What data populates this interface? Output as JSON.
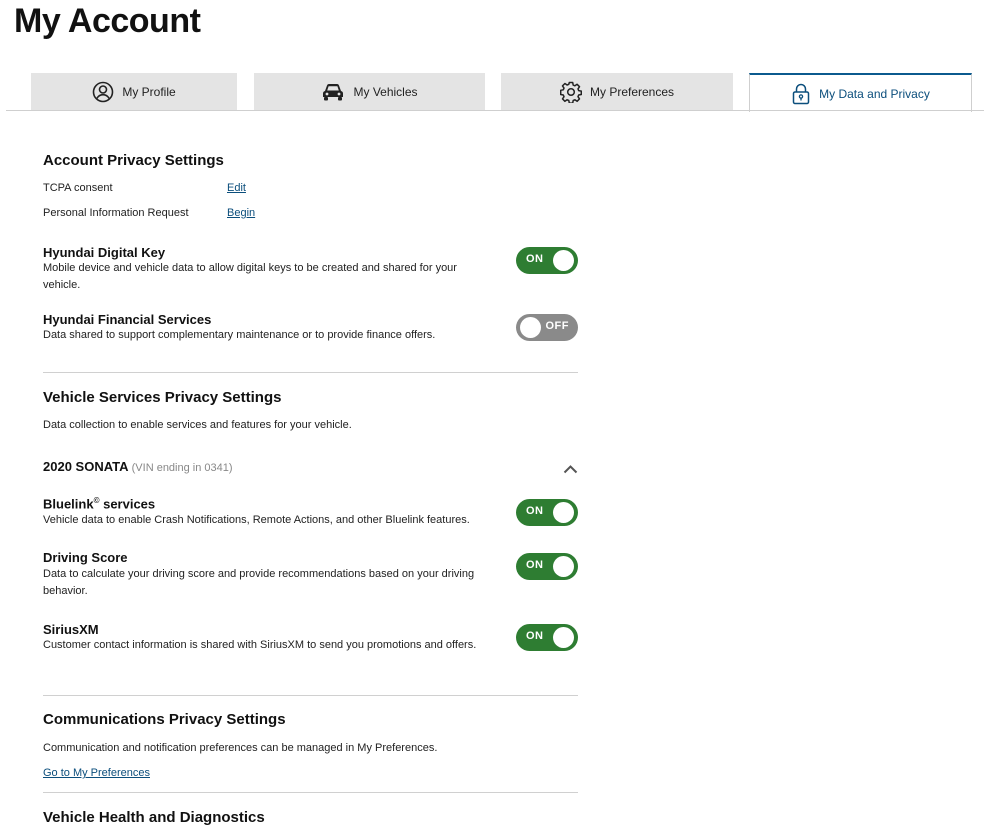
{
  "page_title": "My Account",
  "tabs": [
    {
      "label": "My Profile",
      "icon": "user-circle-icon",
      "active": false
    },
    {
      "label": "My Vehicles",
      "icon": "car-icon",
      "active": false
    },
    {
      "label": "My Preferences",
      "icon": "gear-icon",
      "active": false
    },
    {
      "label": "My Data and Privacy",
      "icon": "lock-icon",
      "active": true
    }
  ],
  "account_privacy": {
    "title": "Account Privacy Settings",
    "rows": [
      {
        "label": "TCPA consent",
        "link": "Edit"
      },
      {
        "label": "Personal Information Request",
        "link": "Begin"
      }
    ],
    "toggles": [
      {
        "title": "Hyundai Digital Key",
        "desc": "Mobile device and vehicle data to allow digital keys to be created and shared for your vehicle.",
        "state": "ON"
      },
      {
        "title": "Hyundai Financial Services",
        "desc": "Data shared to support complementary maintenance or to provide finance offers.",
        "state": "OFF"
      }
    ]
  },
  "vehicle_privacy": {
    "title": "Vehicle Services Privacy Settings",
    "desc": "Data collection to enable services and features for your vehicle.",
    "vehicle_name": "2020 SONATA",
    "vehicle_vin": "(VIN ending in 0341)",
    "toggles": [
      {
        "title": "Bluelink",
        "title_sup": "©",
        "title_suffix": " services",
        "desc": "Vehicle data to enable Crash Notifications, Remote Actions, and other Bluelink features.",
        "state": "ON"
      },
      {
        "title": "Driving Score",
        "desc": "Data to calculate your driving score and provide recommendations based on your driving behavior.",
        "state": "ON"
      },
      {
        "title": "SiriusXM",
        "desc": "Customer contact information is shared with SiriusXM to send you promotions and offers.",
        "state": "ON"
      }
    ]
  },
  "communications": {
    "title": "Communications Privacy Settings",
    "desc": "Communication and notification preferences can be managed in My Preferences.",
    "link": "Go to My Preferences"
  },
  "health": {
    "title": "Vehicle Health and Diagnostics"
  },
  "colors": {
    "toggle_on": "#2e7d32",
    "toggle_off": "#8a8a8a",
    "link": "#0b4e7c",
    "tab_bg": "#e4e4e4"
  }
}
